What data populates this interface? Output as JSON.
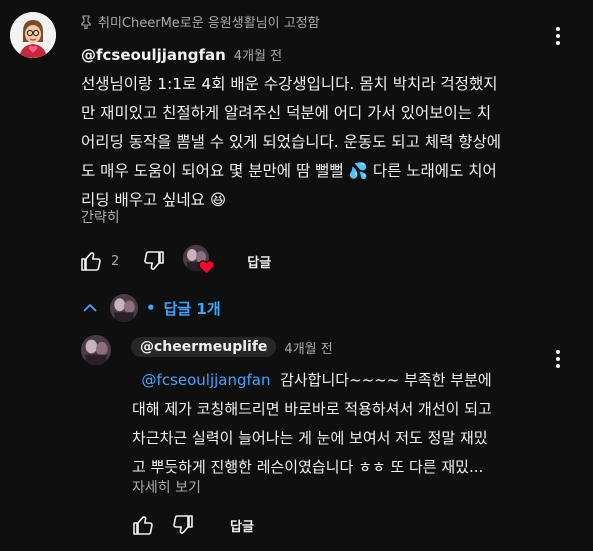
{
  "pinned_comment": {
    "pinned_label": "취미CheerMe로운 응원생활님이 고정함",
    "author": "@fcseouljjangfan",
    "timestamp": "4개월 전",
    "text_lines": [
      "선생님이랑 1:1로 4회 배운 수강생입니다. 몸치 박치라 걱정했지",
      "만 재미있고 친절하게 알려주신 덕분에 어디 가서 있어보이는 치",
      "어리딩 동작을 뽐낼 수 있게 되었습니다. 운동도 되고 체력 향상에",
      "도 매우 도움이 되어요 몇 분만에 땀 뻘뻘",
      "다른 노래에도 치어",
      "리딩 배우고 싶네요"
    ],
    "emoji_sweat": "💦",
    "emoji_smile": "😆",
    "collapse_label": "간략히",
    "like_count": "2",
    "reply_label": "답글",
    "replies_toggle_label": "답글 1개"
  },
  "reply": {
    "author": "@cheermeuplife",
    "timestamp": "4개월 전",
    "mention": "@fcseouljjangfan",
    "first_line_rest": "감사합니다~~~~ 부족한 부분에",
    "text_lines": [
      "대해 제가 코칭해드리면 바로바로 적용하셔서 개선이 되고",
      "차근차근 실력이 늘어나는 게 눈에 보여서 저도 정말 재밌",
      "고 뿌듯하게 진행한 레슨이였습니다 ㅎㅎ 또 다른 재밌..."
    ],
    "read_more_label": "자세히 보기",
    "reply_label": "답글"
  },
  "colors": {
    "background": "#0f0f0f",
    "link_blue": "#3ea6ff",
    "secondary_text": "#aaaaaa",
    "heart_red": "#ff0033"
  }
}
